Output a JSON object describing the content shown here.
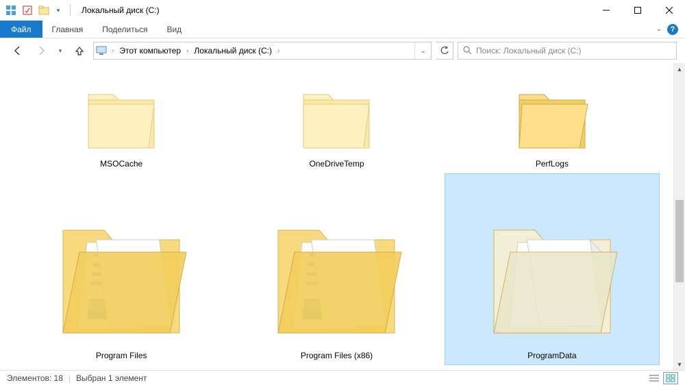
{
  "window": {
    "title": "Локальный диск (C:)"
  },
  "ribbon": {
    "file": "Файл",
    "tabs": [
      "Главная",
      "Поделиться",
      "Вид"
    ]
  },
  "breadcrumb": {
    "items": [
      "Этот компьютер",
      "Локальный диск (C:)"
    ]
  },
  "search": {
    "placeholder": "Поиск: Локальный диск (C:)"
  },
  "folders": [
    {
      "name": "MSOCache",
      "size": "small",
      "content": false,
      "selected": false
    },
    {
      "name": "OneDriveTemp",
      "size": "small",
      "content": false,
      "selected": false
    },
    {
      "name": "PerfLogs",
      "size": "small",
      "content": false,
      "selected": false
    },
    {
      "name": "Program Files",
      "size": "large",
      "content": true,
      "selected": false
    },
    {
      "name": "Program Files (x86)",
      "size": "large",
      "content": true,
      "selected": false
    },
    {
      "name": "ProgramData",
      "size": "large",
      "content": true,
      "selected": true
    }
  ],
  "status": {
    "count_label": "Элементов:",
    "count": "18",
    "selected_label": "Выбран 1 элемент"
  }
}
